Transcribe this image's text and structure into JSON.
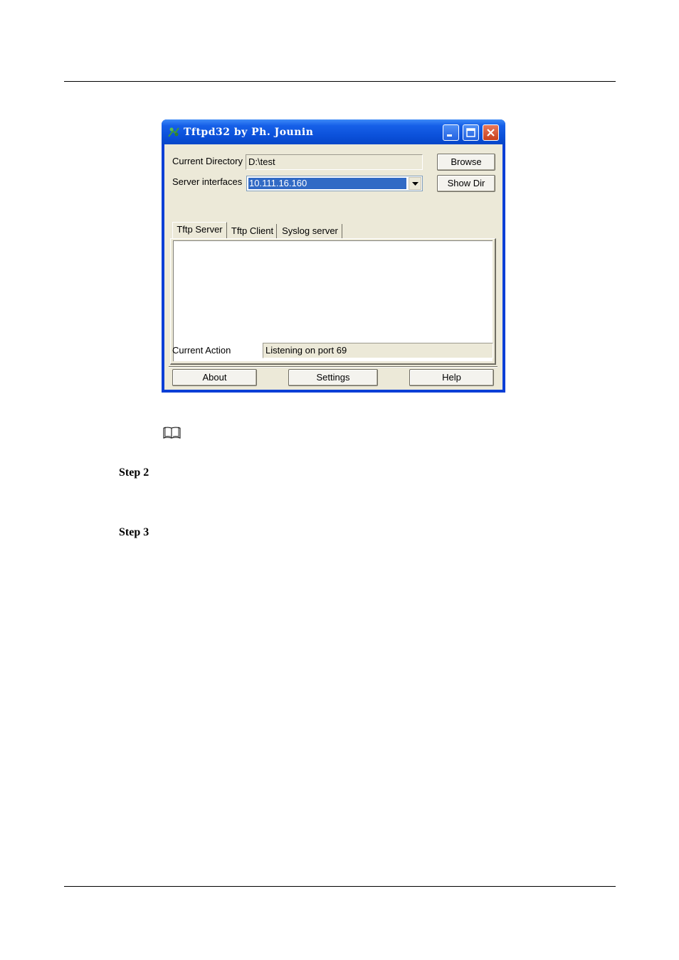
{
  "window": {
    "title": "Tftpd32 by Ph. Jounin",
    "fields": {
      "current_directory_label": "Current Directory",
      "current_directory_value": "D:\\test",
      "server_interfaces_label": "Server interfaces",
      "server_interfaces_value": "10.111.16.160",
      "browse_label": "Browse",
      "showdir_label": "Show Dir"
    },
    "tabs": [
      {
        "label": "Tftp Server"
      },
      {
        "label": "Tftp Client"
      },
      {
        "label": "Syslog server"
      }
    ],
    "status": {
      "current_action_label": "Current Action",
      "current_action_value": "Listening on port 69"
    },
    "buttons": {
      "about": "About",
      "settings": "Settings",
      "help": "Help"
    }
  },
  "document": {
    "steps": [
      "Step 2",
      "Step 3"
    ],
    "note_icon": "book-icon"
  },
  "colors": {
    "titlebar": "#0a4fd8",
    "window_face": "#ece9d8",
    "selection": "#316ac5",
    "close_button": "#c8401d"
  }
}
